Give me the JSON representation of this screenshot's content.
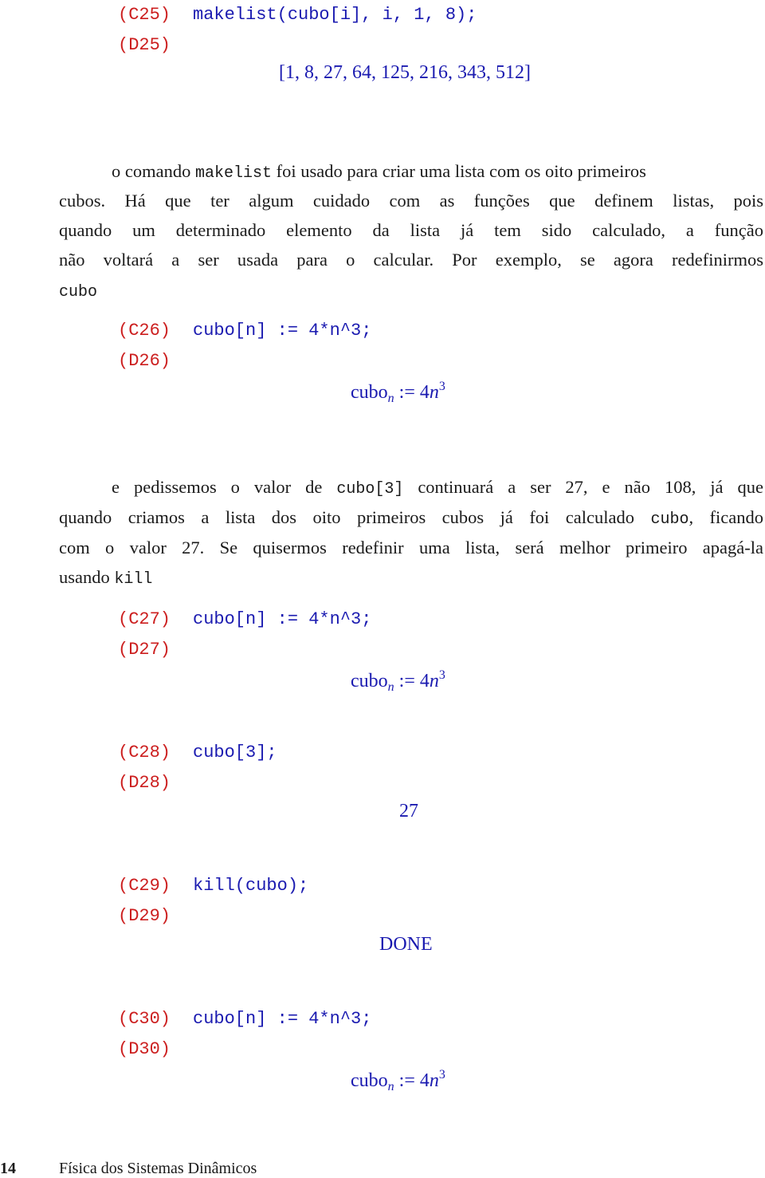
{
  "sessions": [
    {
      "input_label": "(C25)",
      "input_code": "makelist(cubo[i], i, 1, 8);",
      "output_label": "(D25)",
      "output_text": "[1, 8, 27, 64, 125, 216, 343, 512]"
    },
    {
      "input_label": "(C26)",
      "input_code": "cubo[n] := 4*n^3;",
      "output_label": "(D26)",
      "output_base": "cubo",
      "output_sub": "n",
      "output_op": " := 4",
      "output_var": "n",
      "output_sup": "3"
    },
    {
      "input_label": "(C27)",
      "input_code": "cubo[n] := 4*n^3;",
      "output_label": "(D27)",
      "output_base": "cubo",
      "output_sub": "n",
      "output_op": " := 4",
      "output_var": "n",
      "output_sup": "3"
    },
    {
      "input_label": "(C28)",
      "input_code": "cubo[3];",
      "output_label": "(D28)",
      "output_text": "27"
    },
    {
      "input_label": "(C29)",
      "input_code": "kill(cubo);",
      "output_label": "(D29)",
      "output_text": "DONE"
    },
    {
      "input_label": "(C30)",
      "input_code": "cubo[n] := 4*n^3;",
      "output_label": "(D30)",
      "output_base": "cubo",
      "output_sub": "n",
      "output_op": " := 4",
      "output_var": "n",
      "output_sup": "3"
    }
  ],
  "paragraph1": {
    "l1_a": "o comando ",
    "l1_code": "makelist",
    "l1_b": " foi usado para criar uma lista com os oito primeiros",
    "l2": "cubos.  Há que ter algum cuidado com as funções que definem listas, pois",
    "l3": "quando um determinado elemento da lista já tem sido calculado, a função",
    "l4": "não voltará a ser usada para o calcular.  Por exemplo, se agora redefinirmos",
    "l5_code": "cubo"
  },
  "paragraph2": {
    "l1_a": "e pedissemos o valor de ",
    "l1_code": "cubo[3]",
    "l1_b": " continuará a ser 27, e não 108, já que",
    "l2_a": "quando criamos a lista dos oito primeiros cubos já foi calculado ",
    "l2_code": "cubo",
    "l2_b": ", ficando",
    "l3": "com o valor 27.  Se quisermos redefinir uma lista, será melhor primeiro apagá-la",
    "l4_a": "usando ",
    "l4_code": "kill"
  },
  "footer": {
    "page_number": "14",
    "book_title": "Física dos Sistemas Dinâmicos"
  },
  "colors": {
    "input_label": "#cc1f1f",
    "code": "#1a1ab0",
    "body_text": "#1a1a1a"
  }
}
